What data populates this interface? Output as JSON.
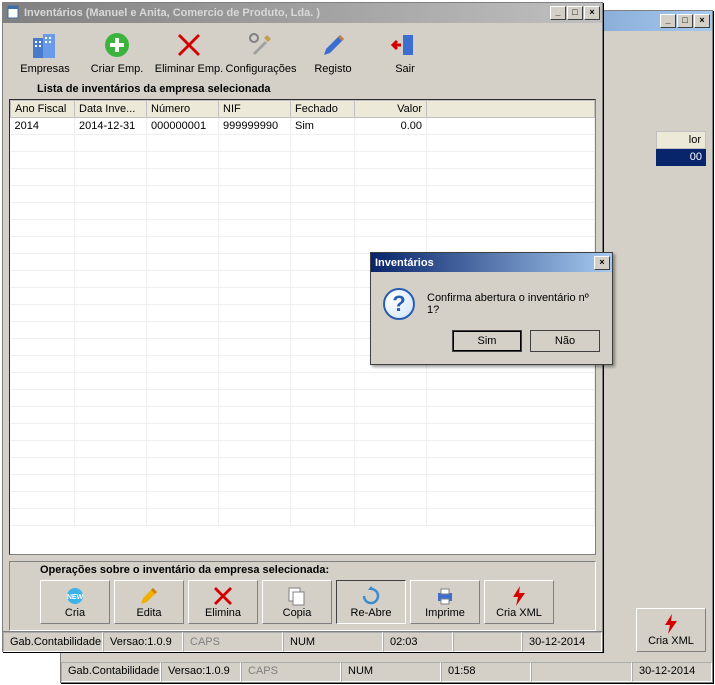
{
  "main_window": {
    "title": "Inventários (Manuel e Anita, Comercio de Produto, Lda. )",
    "toolbar": [
      {
        "label": "Empresas",
        "icon": "buildings-icon"
      },
      {
        "label": "Criar Emp.",
        "icon": "plus-circle-icon"
      },
      {
        "label": "Eliminar Emp.",
        "icon": "x-red-icon"
      },
      {
        "label": "Configurações",
        "icon": "tools-icon"
      },
      {
        "label": "Registo",
        "icon": "pencil-icon"
      },
      {
        "label": "Sair",
        "icon": "exit-door-icon"
      }
    ],
    "list_label": "Lista de inventários da empresa selecionada",
    "table": {
      "headers": [
        "Ano Fiscal",
        "Data Inve...",
        "Número",
        "NIF",
        "Fechado",
        "Valor"
      ],
      "rows": [
        {
          "ano": "2014",
          "data": "2014-12-31",
          "numero": "000000001",
          "nif": "999999990",
          "fechado": "Sim",
          "valor": "0.00"
        }
      ]
    },
    "ops_label": "Operações sobre o inventário da empresa selecionada:",
    "ops": [
      {
        "label": "Cria",
        "icon": "new-star-icon"
      },
      {
        "label": "Edita",
        "icon": "pencil-yellow-icon"
      },
      {
        "label": "Elimina",
        "icon": "x-red-icon"
      },
      {
        "label": "Copia",
        "icon": "copy-icon"
      },
      {
        "label": "Re-Abre",
        "icon": "refresh-icon",
        "active": true
      },
      {
        "label": "Imprime",
        "icon": "printer-icon"
      },
      {
        "label": "Cria XML",
        "icon": "bolt-icon"
      }
    ],
    "status": {
      "gab": "Gab.Contabilidade",
      "versao": "Versao:1.0.9",
      "caps": "CAPS",
      "num": "NUM",
      "time": "02:03",
      "date": "30-12-2014"
    }
  },
  "dialog": {
    "title": "Inventários",
    "message": "Confirma abertura o inventário nº 1?",
    "yes": "Sim",
    "no": "Não"
  },
  "bg_window": {
    "col_header": "lor",
    "cell": "00",
    "op_label": "Cria XML",
    "status": {
      "gab": "Gab.Contabilidade",
      "versao": "Versao:1.0.9",
      "caps": "CAPS",
      "num": "NUM",
      "time": "01:58",
      "date": "30-12-2014"
    }
  }
}
